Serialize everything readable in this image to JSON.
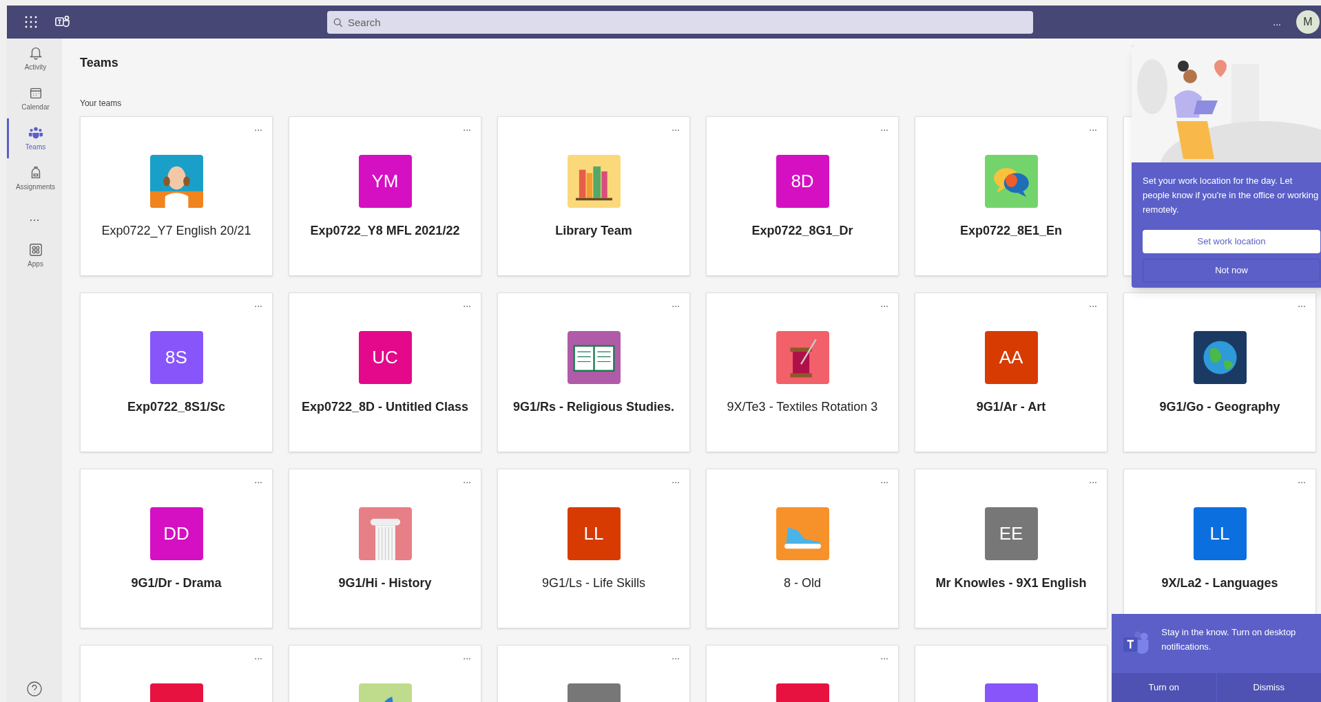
{
  "top_bar": {
    "search": {
      "placeholder": "Search"
    },
    "more": "...",
    "avatar": "M"
  },
  "sidebar": {
    "items": [
      {
        "kind": "bell",
        "label": "Activity",
        "selected": false
      },
      {
        "kind": "calendar",
        "label": "Calendar",
        "selected": false
      },
      {
        "kind": "teams",
        "label": "Teams",
        "selected": true
      },
      {
        "kind": "backpack",
        "label": "Assignments",
        "selected": false
      },
      {
        "kind": "more",
        "label": "..."
      },
      {
        "kind": "apps",
        "label": "Apps",
        "selected": false
      }
    ]
  },
  "page": {
    "title": "Teams",
    "section": "Your teams"
  },
  "teams": [
    {
      "kind": "portrait",
      "color": "#1aa0c8",
      "menu": "...",
      "name": "Exp0722_Y7 English 20/21",
      "bold": false
    },
    {
      "kind": "initials",
      "initials": "YM",
      "color": "#d510c2",
      "menu": "...",
      "name": "Exp0722_Y8 MFL 2021/22",
      "bold": true
    },
    {
      "kind": "books",
      "color": "#fbd97a",
      "menu": "...",
      "name": "Library Team",
      "bold": true
    },
    {
      "kind": "initials",
      "initials": "8D",
      "color": "#d510c2",
      "menu": "...",
      "name": "Exp0722_8G1_Dr",
      "bold": true
    },
    {
      "kind": "speech",
      "color": "#74d46c",
      "menu": "...",
      "name": "Exp0722_8E1_En",
      "bold": true
    },
    {
      "kind": "covered"
    },
    {
      "kind": "initials",
      "initials": "8S",
      "color": "#8855fb",
      "menu": "...",
      "name": "Exp0722_8S1/Sc",
      "bold": true
    },
    {
      "kind": "initials",
      "initials": "UC",
      "color": "#e3098a",
      "menu": "...",
      "name": "Exp0722_8D - Untitled Class",
      "bold": true
    },
    {
      "kind": "book",
      "color": "#b05ba8",
      "menu": "...",
      "name": "9G1/Rs - Religious Studies.",
      "bold": true
    },
    {
      "kind": "sewing",
      "color": "#f2606a",
      "menu": "...",
      "name": "9X/Te3 - Textiles Rotation 3",
      "bold": false
    },
    {
      "kind": "initials",
      "initials": "AA",
      "color": "#d83b01",
      "menu": "...",
      "name": "9G1/Ar - Art",
      "bold": true
    },
    {
      "kind": "globe",
      "color": "#1b3a63",
      "menu": "...",
      "name": "9G1/Go - Geography",
      "bold": true
    },
    {
      "kind": "initials",
      "initials": "DD",
      "color": "#d510c2",
      "menu": "...",
      "name": "9G1/Dr - Drama",
      "bold": true
    },
    {
      "kind": "column",
      "color": "#e77f86",
      "menu": "...",
      "name": "9G1/Hi - History",
      "bold": true
    },
    {
      "kind": "initials",
      "initials": "LL",
      "color": "#d83b01",
      "menu": "...",
      "name": "9G1/Ls - Life Skills",
      "bold": false
    },
    {
      "kind": "shoe",
      "color": "#f7922b",
      "menu": "...",
      "name": "8 - Old",
      "bold": false
    },
    {
      "kind": "initials",
      "initials": "EE",
      "color": "#777777",
      "menu": "...",
      "name": "Mr Knowles - 9X1 English",
      "bold": true
    },
    {
      "kind": "initials",
      "initials": "LL",
      "color": "#0b6fe0",
      "menu": "...",
      "name": "9X/La2 - Languages",
      "bold": true
    },
    {
      "kind": "initials",
      "color": "#e81240",
      "menu": "..."
    },
    {
      "kind": "leaf",
      "color": "#bedc8c",
      "menu": "..."
    },
    {
      "kind": "initials",
      "color": "#777777",
      "menu": "..."
    },
    {
      "kind": "initials",
      "color": "#e81240",
      "menu": "..."
    },
    {
      "kind": "initials",
      "color": "#8855fb"
    },
    {
      "kind": "covered"
    }
  ],
  "location_prompt": {
    "message": "Set your work location for the day. Let people know if you're in the office or working remotely.",
    "buttons": [
      "Set work location",
      "Not now"
    ]
  },
  "notification": {
    "message": "Stay in the know. Turn on desktop notifications.",
    "buttons": [
      "Turn on",
      "Dismiss"
    ]
  }
}
